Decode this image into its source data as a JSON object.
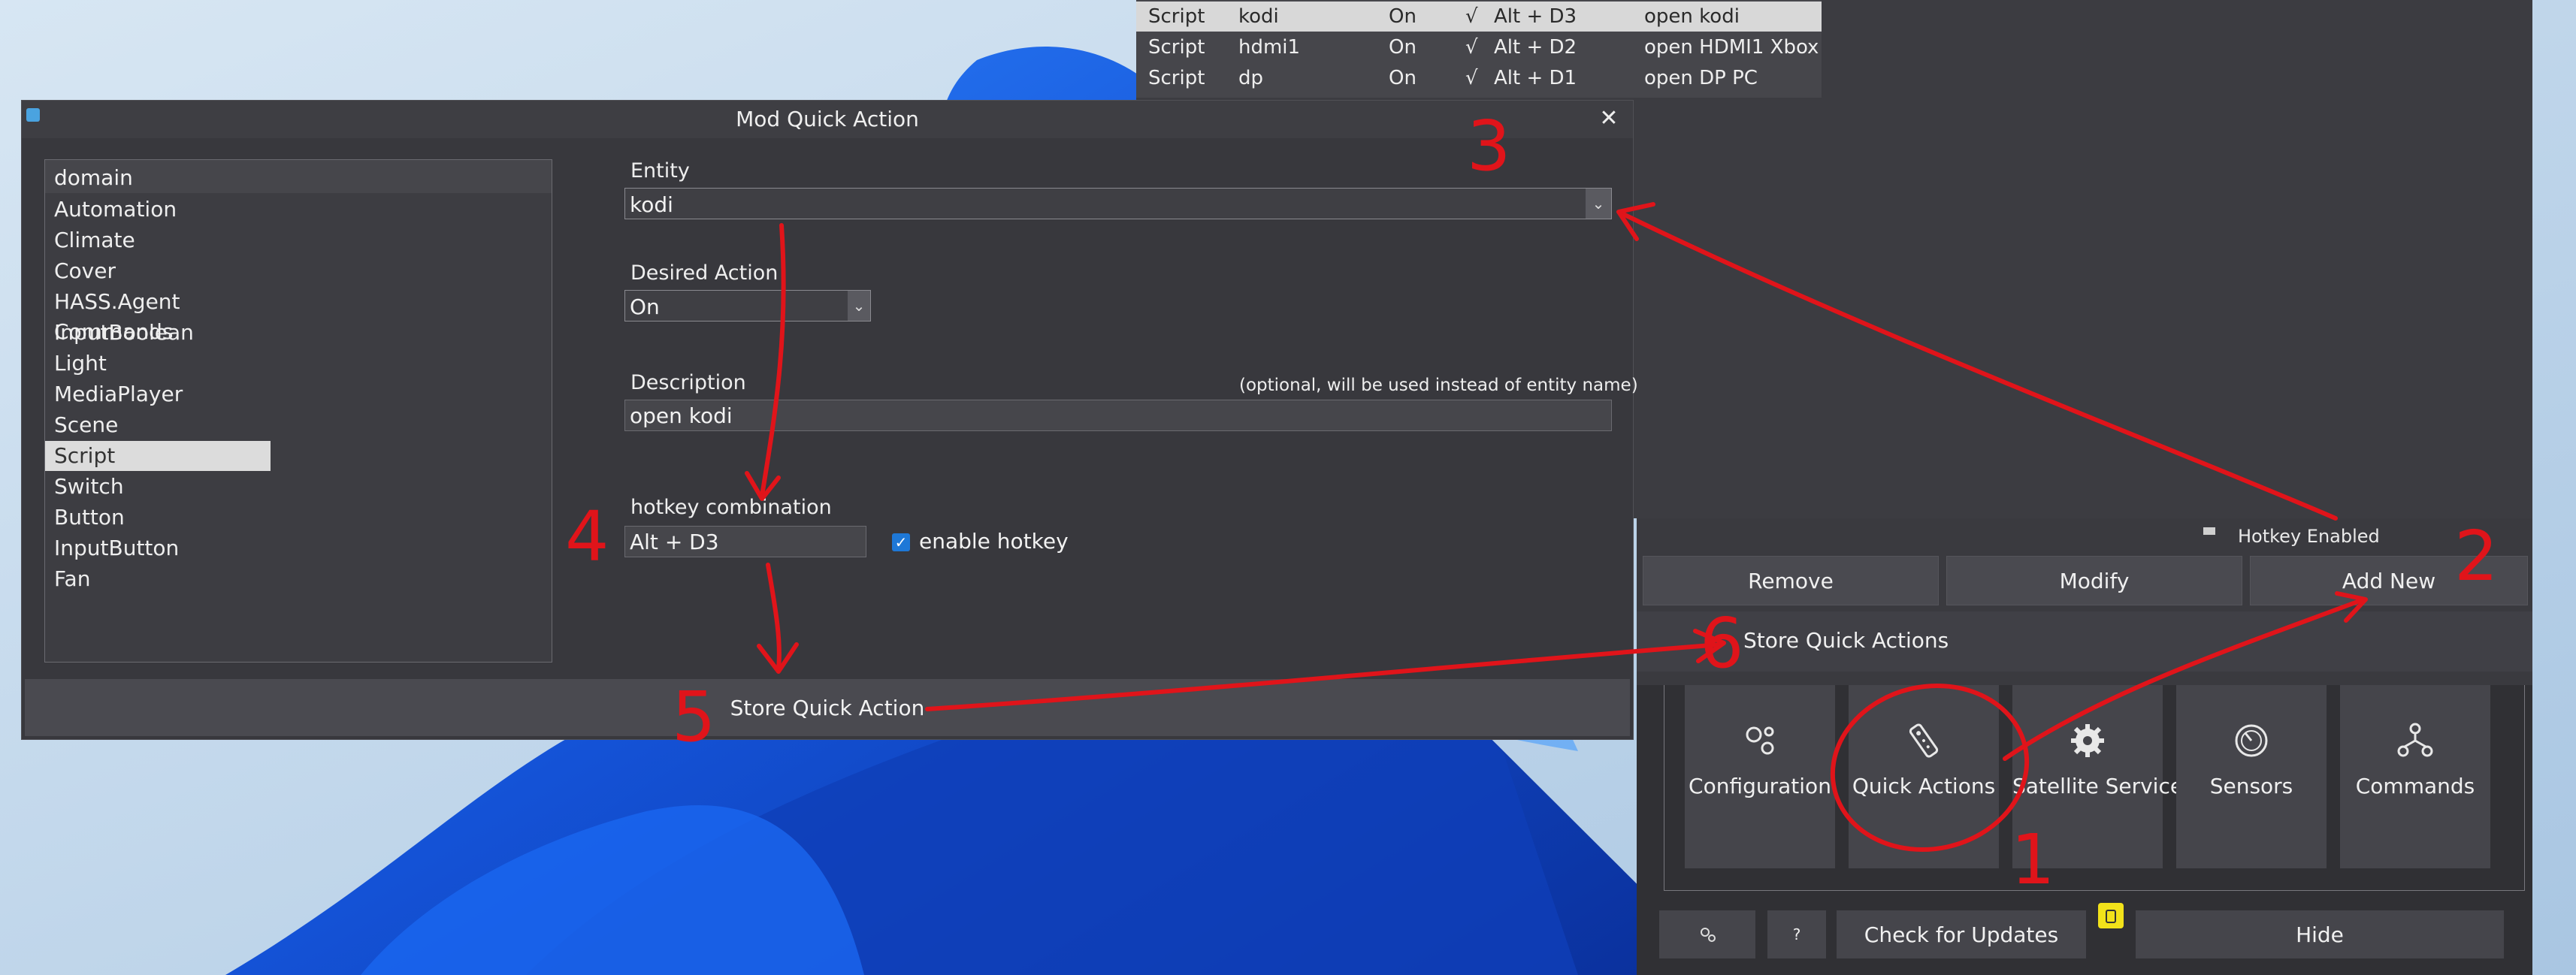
{
  "quick_actions_list": {
    "rows": [
      {
        "type": "Script",
        "entity": "kodi",
        "action": "On",
        "enabled": "√",
        "hotkey": "Alt + D3",
        "description": "open kodi",
        "selected": true
      },
      {
        "type": "Script",
        "entity": "hdmi1",
        "action": "On",
        "enabled": "√",
        "hotkey": "Alt + D2",
        "description": "open HDMI1 Xbox",
        "selected": false
      },
      {
        "type": "Script",
        "entity": "dp",
        "action": "On",
        "enabled": "√",
        "hotkey": "Alt + D1",
        "description": "open DP PC",
        "selected": false
      }
    ],
    "hotkey_enabled_label": "Hotkey Enabled",
    "buttons": {
      "remove": "Remove",
      "modify": "Modify",
      "add_new": "Add New"
    },
    "store_quick_actions_label": "Store Quick Actions"
  },
  "main_tiles": [
    {
      "label": "Configuration",
      "icon": "gears-icon"
    },
    {
      "label": "Quick Actions",
      "icon": "remote-control-icon"
    },
    {
      "label": "Satellite Service",
      "icon": "gear-icon"
    },
    {
      "label": "Sensors",
      "icon": "gauge-icon"
    },
    {
      "label": "Commands",
      "icon": "network-icon"
    }
  ],
  "bottom_bar": {
    "check_updates": "Check for Updates",
    "help": "?",
    "hide": "Hide"
  },
  "dialog": {
    "title": "Mod Quick Action",
    "close": "✕",
    "domain_header": "domain",
    "domains": [
      "Automation",
      "Climate",
      "Cover",
      "HASS.Agent Commands",
      "InputBoolean",
      "Light",
      "MediaPlayer",
      "Scene",
      "Script",
      "Switch",
      "Button",
      "InputButton",
      "Fan"
    ],
    "selected_domain": "Script",
    "entity_label": "Entity",
    "entity_value": "kodi",
    "desired_action_label": "Desired Action",
    "desired_action_value": "On",
    "description_label": "Description",
    "description_hint": "(optional, will be used instead of entity name)",
    "description_value": "open kodi",
    "hotkey_label": "hotkey combination",
    "hotkey_value": "Alt + D3",
    "enable_hotkey_label": "enable hotkey",
    "enable_hotkey_checked": true,
    "store_button": "Store Quick Action"
  },
  "annotations": {
    "step1": "1",
    "step2": "2",
    "step3": "3",
    "step4": "4",
    "step5": "5",
    "step6": "6",
    "color": "#e0141a"
  },
  "colors": {
    "accent": "#1e78d7",
    "dark_bg": "#38383d",
    "wallpaper_blue": "#1f5fd8"
  }
}
